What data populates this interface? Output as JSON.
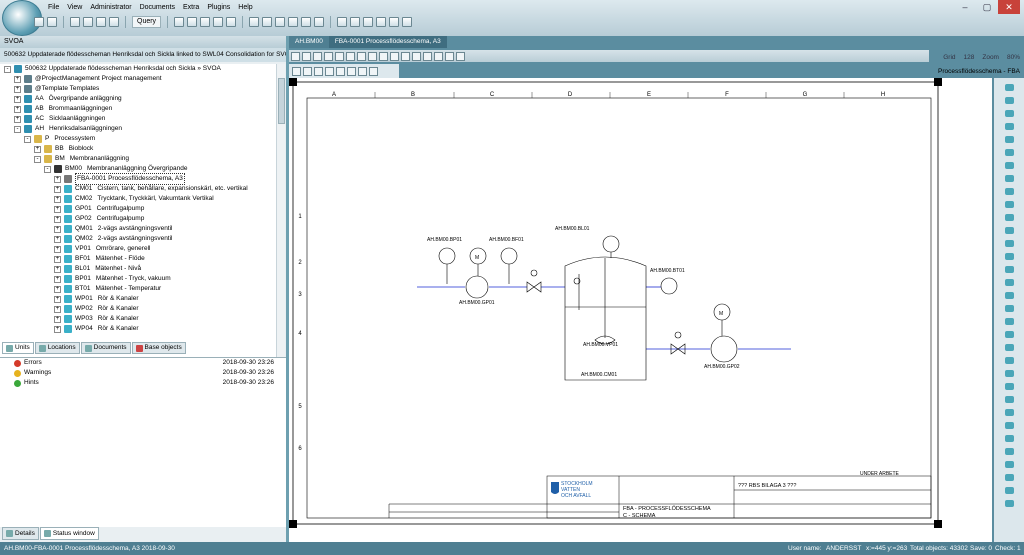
{
  "menu": [
    "File",
    "View",
    "Administrator",
    "Documents",
    "Extra",
    "Plugins",
    "Help"
  ],
  "toolbar": {
    "query_label": "Query"
  },
  "left": {
    "project_header": "SVOA",
    "project_title": "500632  Uppdaterade flödesscheman Henriksdal och Sickla linked to SWL04  Consolidation for SVOA Ad",
    "tree": [
      {
        "pm": "-",
        "code": "",
        "label": "500632  Uppdaterade flödesscheman Henriksdal och Sickla  »  SVOA",
        "indent": 0,
        "color": "#2f8fb0"
      },
      {
        "pm": "+",
        "code": "",
        "label": "@ProjectManagement  Project management",
        "indent": 1,
        "color": "#5c7d8a"
      },
      {
        "pm": "+",
        "code": "",
        "label": "@Template  Templates",
        "indent": 1,
        "color": "#5c7d8a"
      },
      {
        "pm": "+",
        "code": "AA",
        "label": "Övergripande anläggning",
        "indent": 1,
        "color": "#2f8fb0"
      },
      {
        "pm": "+",
        "code": "AB",
        "label": "Brommaanläggningen",
        "indent": 1,
        "color": "#2f8fb0"
      },
      {
        "pm": "+",
        "code": "AC",
        "label": "Sicklaanläggningen",
        "indent": 1,
        "color": "#2f8fb0"
      },
      {
        "pm": "-",
        "code": "AH",
        "label": "Henriksdalsanläggningen",
        "indent": 1,
        "color": "#2f8fb0"
      },
      {
        "pm": "-",
        "code": "P",
        "label": "Processystem",
        "indent": 2,
        "color": "#d9b64a"
      },
      {
        "pm": "+",
        "code": "BB",
        "label": "Bioblock",
        "indent": 3,
        "color": "#d9b64a"
      },
      {
        "pm": "-",
        "code": "BM",
        "label": "Membrananläggning",
        "indent": 3,
        "color": "#d9b64a"
      },
      {
        "pm": "-",
        "code": "BM00",
        "label": "Membrananläggning Övergripande",
        "indent": 4,
        "color": "#333"
      },
      {
        "pm": "+",
        "code": "",
        "label": "FBA-0001  Processflödesschema, A3",
        "indent": 5,
        "color": "#777",
        "sel": true
      },
      {
        "pm": "+",
        "code": "CM01",
        "label": "Cistern, tank, behållare, expansionskärl, etc. vertikal",
        "indent": 5,
        "color": "#3ab0c8"
      },
      {
        "pm": "+",
        "code": "CM02",
        "label": "Trycktank, Tryckkärl, Vakumtank Vertikal",
        "indent": 5,
        "color": "#3ab0c8"
      },
      {
        "pm": "+",
        "code": "GP01",
        "label": "Centrifugalpump",
        "indent": 5,
        "color": "#3ab0c8"
      },
      {
        "pm": "+",
        "code": "GP02",
        "label": "Centrifugalpump",
        "indent": 5,
        "color": "#3ab0c8"
      },
      {
        "pm": "+",
        "code": "QM01",
        "label": "2-vägs avstängningsventil",
        "indent": 5,
        "color": "#3ab0c8"
      },
      {
        "pm": "+",
        "code": "QM02",
        "label": "2-vägs avstängningsventil",
        "indent": 5,
        "color": "#3ab0c8"
      },
      {
        "pm": "+",
        "code": "VP01",
        "label": "Omrörare, generell",
        "indent": 5,
        "color": "#3ab0c8"
      },
      {
        "pm": "+",
        "code": "BF01",
        "label": "Mätenhet - Flöde",
        "indent": 5,
        "color": "#3ab0c8"
      },
      {
        "pm": "+",
        "code": "BL01",
        "label": "Mätenhet - Nivå",
        "indent": 5,
        "color": "#3ab0c8"
      },
      {
        "pm": "+",
        "code": "BP01",
        "label": "Mätenhet - Tryck, vakuum",
        "indent": 5,
        "color": "#3ab0c8"
      },
      {
        "pm": "+",
        "code": "BT01",
        "label": "Mätenhet - Temperatur",
        "indent": 5,
        "color": "#3ab0c8"
      },
      {
        "pm": "+",
        "code": "WP01",
        "label": "Rör & Kanaler",
        "indent": 5,
        "color": "#3ab0c8"
      },
      {
        "pm": "+",
        "code": "WP02",
        "label": "Rör & Kanaler",
        "indent": 5,
        "color": "#3ab0c8"
      },
      {
        "pm": "+",
        "code": "WP03",
        "label": "Rör & Kanaler",
        "indent": 5,
        "color": "#3ab0c8"
      },
      {
        "pm": "+",
        "code": "WP04",
        "label": "Rör & Kanaler",
        "indent": 5,
        "color": "#3ab0c8"
      }
    ],
    "tabs": [
      "Units",
      "Locations",
      "Documents",
      "Base objects"
    ],
    "status": [
      {
        "label": "Errors",
        "date": "2018-09-30 23:26",
        "color": "#d43a2a"
      },
      {
        "label": "Warnings",
        "date": "2018-09-30 23:26",
        "color": "#e6b21e"
      },
      {
        "label": "Hints",
        "date": "2018-09-30 23:26",
        "color": "#3aa83a"
      }
    ],
    "bottom_tabs": [
      "Details",
      "Status window"
    ]
  },
  "drawing": {
    "tabs": [
      "AH.BM00",
      "FBA-0001  Processflödesschema, A3"
    ],
    "grid": "Grid",
    "grid_val": "128",
    "zoom": "Zoom",
    "zoom_val": "80%",
    "sheet_name": "Processflödesschema - FBA",
    "col_labels": [
      "A",
      "B",
      "C",
      "D",
      "E",
      "F",
      "G",
      "H"
    ],
    "row_labels": [
      "1",
      "2",
      "3",
      "4",
      "5",
      "6"
    ],
    "tags": {
      "bp01": "AH.BM00.BP01",
      "bf01": "AH.BM00.BF01",
      "bl01": "AH.BM00.BL01",
      "bt01": "AH.BM00.BT01",
      "gp01": "AH.BM00.GP01",
      "vp01": "AH.BM00.VP01",
      "cm01": "AH.BM00.CM01",
      "gp02": "AH.BM00.GP02",
      "m": "M"
    },
    "under_arbete": "UNDER ARBETE",
    "title_block": {
      "org1": "STOCKHOLM",
      "org2": "VATTEN",
      "org3": "OCH AVFALL",
      "bilaga": "??? RBS BILAGA 3 ???",
      "doc_title": "FBA - PROCESSFLÖDESSCHEMA",
      "doc_sub": "C - SCHEMA"
    }
  },
  "statusbar": {
    "left": "AH.BM00-FBA-0001   Processflödesschema, A3     2018-09-30",
    "user_label": "User name:",
    "user": "ANDERSST",
    "coords": "x:=445 y:=263",
    "total": "Total objects: 43302",
    "save": "Save: 0",
    "check": "Check: 1"
  },
  "colors": {
    "accent": "#4f7f92",
    "window": "#6ea0b0"
  }
}
